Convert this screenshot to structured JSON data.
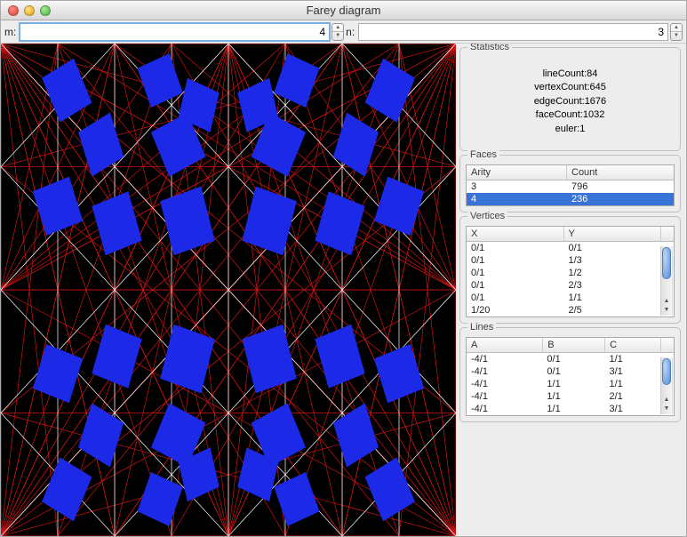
{
  "window": {
    "title": "Farey diagram"
  },
  "inputs": {
    "m": {
      "label": "m:",
      "value": "4"
    },
    "n": {
      "label": "n:",
      "value": "3"
    }
  },
  "statistics": {
    "legend": "Statistics",
    "lineCount_label": "lineCount:84",
    "vertexCount_label": "vertexCount:645",
    "edgeCount_label": "edgeCount:1676",
    "faceCount_label": "faceCount:1032",
    "euler_label": "euler:1"
  },
  "faces": {
    "legend": "Faces",
    "headers": {
      "arity": "Arity",
      "count": "Count"
    },
    "rows": [
      {
        "arity": "3",
        "count": "796",
        "selected": false
      },
      {
        "arity": "4",
        "count": "236",
        "selected": true
      }
    ]
  },
  "vertices": {
    "legend": "Vertices",
    "headers": {
      "x": "X",
      "y": "Y"
    },
    "rows": [
      {
        "x": "0/1",
        "y": "0/1"
      },
      {
        "x": "0/1",
        "y": "1/3"
      },
      {
        "x": "0/1",
        "y": "1/2"
      },
      {
        "x": "0/1",
        "y": "2/3"
      },
      {
        "x": "0/1",
        "y": "1/1"
      },
      {
        "x": "1/20",
        "y": "2/5"
      }
    ]
  },
  "lines": {
    "legend": "Lines",
    "headers": {
      "a": "A",
      "b": "B",
      "c": "C"
    },
    "rows": [
      {
        "a": "-4/1",
        "b": "0/1",
        "c": "1/1"
      },
      {
        "a": "-4/1",
        "b": "0/1",
        "c": "3/1"
      },
      {
        "a": "-4/1",
        "b": "1/1",
        "c": "1/1"
      },
      {
        "a": "-4/1",
        "b": "1/1",
        "c": "2/1"
      },
      {
        "a": "-4/1",
        "b": "1/1",
        "c": "3/1"
      }
    ]
  }
}
